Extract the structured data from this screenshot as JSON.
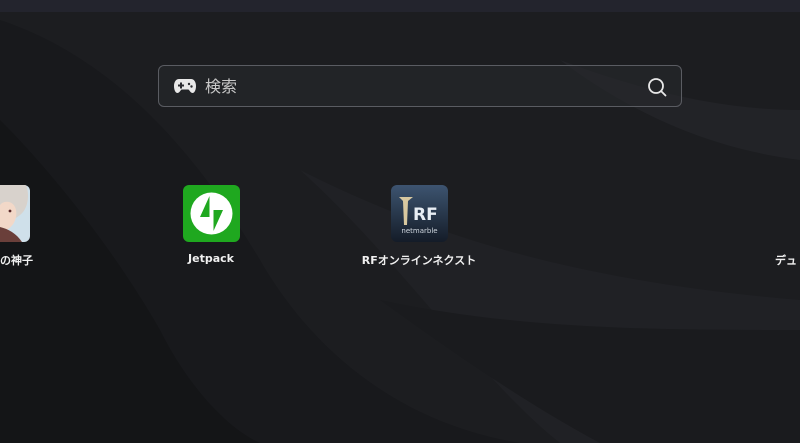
{
  "search": {
    "placeholder": "検索",
    "value": ""
  },
  "apps": [
    {
      "label": "の神子",
      "icon": "anime-character-icon",
      "partial": "left"
    },
    {
      "label": "Jetpack",
      "icon": "jetpack-lightning-icon",
      "icon_bg": "#1fa81f"
    },
    {
      "label": "RFオンラインネクスト",
      "icon": "rf-netmarble-icon",
      "icon_text": "RF",
      "icon_subtext": "netmarble"
    },
    {
      "label": "デュ",
      "icon": "",
      "partial": "right"
    }
  ],
  "colors": {
    "background": "#1c1d20",
    "search_border": "#5a5c62",
    "text": "#f0f0f0",
    "jetpack_green": "#1fa81f"
  }
}
